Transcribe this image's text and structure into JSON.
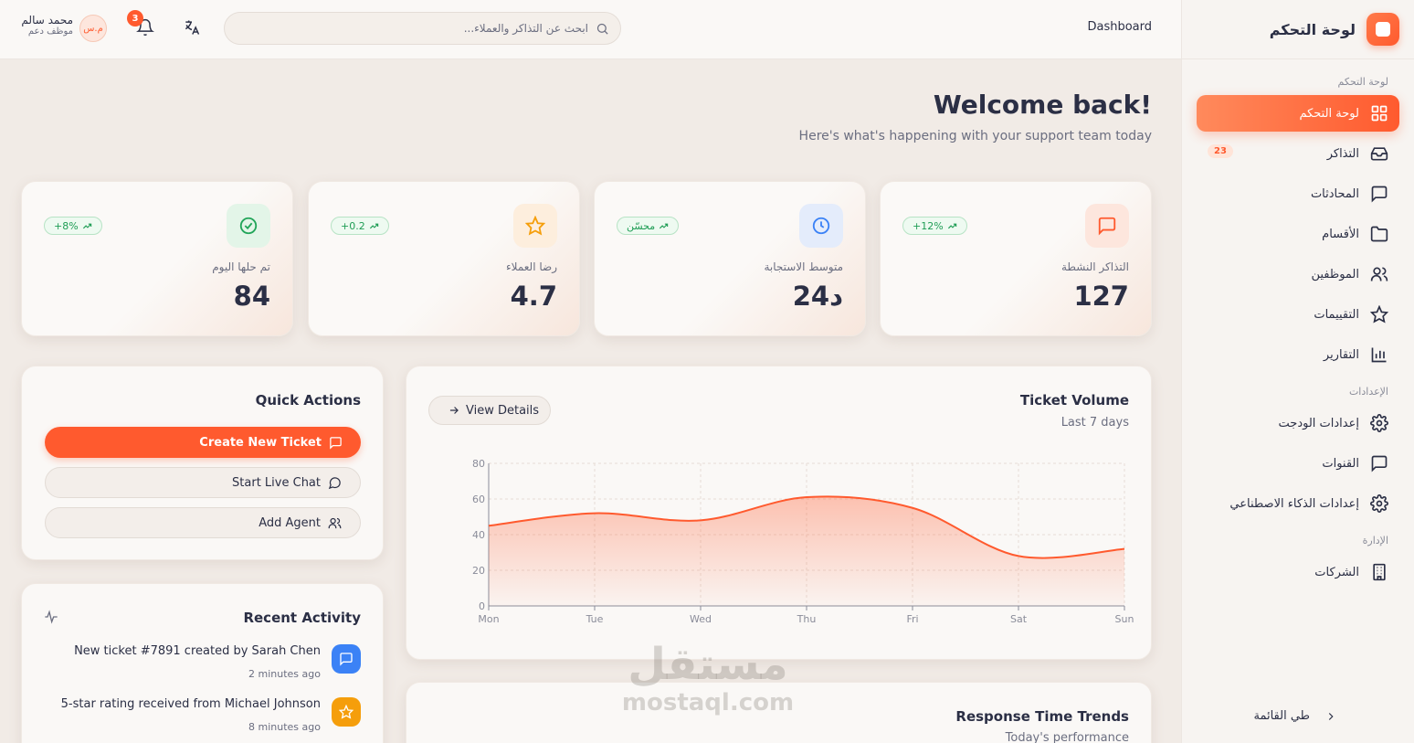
{
  "sidebar": {
    "brand": "لوحة التحكم",
    "sections": [
      {
        "label": "لوحة التحكم"
      },
      {
        "label": "الإعدادات"
      },
      {
        "label": "الإدارة"
      }
    ],
    "items": [
      {
        "label": "لوحة التحكم",
        "icon": "grid-icon"
      },
      {
        "label": "التذاكر",
        "icon": "inbox-icon",
        "badge": "23"
      },
      {
        "label": "المحادثات",
        "icon": "message-icon"
      },
      {
        "label": "الأقسام",
        "icon": "folder-icon"
      },
      {
        "label": "الموظفين",
        "icon": "users-icon"
      },
      {
        "label": "التقييمات",
        "icon": "star-icon"
      },
      {
        "label": "التقارير",
        "icon": "bar-chart-icon"
      },
      {
        "label": "إعدادات الودجت",
        "icon": "gear-icon"
      },
      {
        "label": "القنوات",
        "icon": "message-icon"
      },
      {
        "label": "إعدادات الذكاء الاصطناعي",
        "icon": "gear-icon"
      },
      {
        "label": "الشركات",
        "icon": "building-icon"
      }
    ],
    "collapse_label": "طي القائمة"
  },
  "header": {
    "breadcrumb": "Dashboard",
    "search_placeholder": "ابحث عن التذاكر والعملاء...",
    "notifications": "3",
    "user": {
      "initials": "م.س",
      "name": "محمد سالم",
      "role": "موظف دعم"
    }
  },
  "welcome": {
    "title": "Welcome back!",
    "subtitle": "Here's what's happening with your support team today"
  },
  "stats": [
    {
      "label": "التذاكر النشطة",
      "value": "127",
      "trend": "+12%",
      "color": "#ff5a2e"
    },
    {
      "label": "متوسط الاستجابة",
      "value": "24د",
      "trend": "محسّن",
      "color": "#3b82f6"
    },
    {
      "label": "رضا العملاء",
      "value": "4.7",
      "trend": "+0.2",
      "color": "#f59e0b"
    },
    {
      "label": "تم حلها اليوم",
      "value": "84",
      "trend": "+8%",
      "color": "#22a559"
    }
  ],
  "quick_actions": {
    "title": "Quick Actions",
    "create": "Create New Ticket",
    "chat": "Start Live Chat",
    "agent": "Add Agent"
  },
  "activity": {
    "title": "Recent Activity",
    "items": [
      {
        "text": "New ticket #7891 created by Sarah Chen",
        "time": "2 minutes ago"
      },
      {
        "text": "5-star rating received from Michael Johnson",
        "time": "8 minutes ago"
      }
    ]
  },
  "ticket_volume": {
    "title": "Ticket Volume",
    "subtitle": "Last 7 days",
    "button": "View Details"
  },
  "response_trends": {
    "title": "Response Time Trends",
    "subtitle": "Today's performance"
  },
  "watermark": {
    "arabic": "مستقل",
    "latin": "mostaql.com"
  },
  "chart_data": {
    "type": "area",
    "categories": [
      "Mon",
      "Tue",
      "Wed",
      "Thu",
      "Fri",
      "Sat",
      "Sun"
    ],
    "values": [
      45,
      52,
      48,
      61,
      55,
      28,
      32
    ],
    "yticks": [
      0,
      20,
      40,
      60,
      80
    ],
    "ylim": [
      0,
      80
    ],
    "grid": true,
    "color": "#ff5a2e"
  }
}
